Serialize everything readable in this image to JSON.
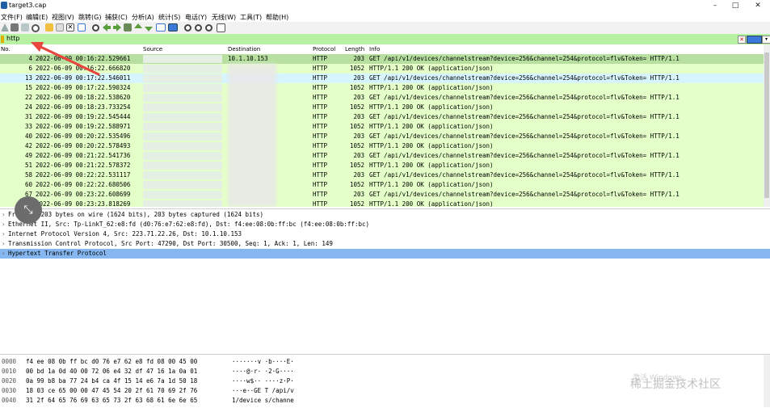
{
  "window": {
    "title": "target3.cap"
  },
  "menu": [
    "文件(F)",
    "编辑(E)",
    "视图(V)",
    "跳转(G)",
    "捕获(C)",
    "分析(A)",
    "统计(S)",
    "电话(Y)",
    "无线(W)",
    "工具(T)",
    "帮助(H)"
  ],
  "filter": {
    "value": "http"
  },
  "columns": {
    "no": "No.",
    "time": "Time",
    "source": "Source",
    "destination": "Destination",
    "protocol": "Protocol",
    "length": "Length",
    "info": "Info"
  },
  "packets": [
    {
      "no": "4",
      "time": "2022-06-09 00:16:22.529661",
      "destination": "10.1.10.153",
      "protocol": "HTTP",
      "length": "203",
      "info": "GET /api/v1/devices/channelstream?device=256&channel=254&protocol=flv&Token= HTTP/1.1"
    },
    {
      "no": "6",
      "time": "2022-06-09 00:16:22.666820",
      "destination": "",
      "protocol": "HTTP",
      "length": "1052",
      "info": "HTTP/1.1 200 OK  (application/json)"
    },
    {
      "no": "13",
      "time": "2022-06-09 00:17:22.546011",
      "destination": "",
      "protocol": "HTTP",
      "length": "203",
      "info": "GET /api/v1/devices/channelstream?device=256&channel=254&protocol=flv&Token= HTTP/1.1"
    },
    {
      "no": "15",
      "time": "2022-06-09 00:17:22.590324",
      "destination": "",
      "protocol": "HTTP",
      "length": "1052",
      "info": "HTTP/1.1 200 OK  (application/json)"
    },
    {
      "no": "22",
      "time": "2022-06-09 00:18:22.538620",
      "destination": "",
      "protocol": "HTTP",
      "length": "203",
      "info": "GET /api/v1/devices/channelstream?device=256&channel=254&protocol=flv&Token= HTTP/1.1"
    },
    {
      "no": "24",
      "time": "2022-06-09 00:18:23.733254",
      "destination": "",
      "protocol": "HTTP",
      "length": "1052",
      "info": "HTTP/1.1 200 OK  (application/json)"
    },
    {
      "no": "31",
      "time": "2022-06-09 00:19:22.545444",
      "destination": "",
      "protocol": "HTTP",
      "length": "203",
      "info": "GET /api/v1/devices/channelstream?device=256&channel=254&protocol=flv&Token= HTTP/1.1"
    },
    {
      "no": "33",
      "time": "2022-06-09 00:19:22.588971",
      "destination": "",
      "protocol": "HTTP",
      "length": "1052",
      "info": "HTTP/1.1 200 OK  (application/json)"
    },
    {
      "no": "40",
      "time": "2022-06-09 00:20:22.535496",
      "destination": "",
      "protocol": "HTTP",
      "length": "203",
      "info": "GET /api/v1/devices/channelstream?device=256&channel=254&protocol=flv&Token= HTTP/1.1"
    },
    {
      "no": "42",
      "time": "2022-06-09 00:20:22.578493",
      "destination": "",
      "protocol": "HTTP",
      "length": "1052",
      "info": "HTTP/1.1 200 OK  (application/json)"
    },
    {
      "no": "49",
      "time": "2022-06-09 00:21:22.541736",
      "destination": "",
      "protocol": "HTTP",
      "length": "203",
      "info": "GET /api/v1/devices/channelstream?device=256&channel=254&protocol=flv&Token= HTTP/1.1"
    },
    {
      "no": "51",
      "time": "2022-06-09 00:21:22.578372",
      "destination": "",
      "protocol": "HTTP",
      "length": "1052",
      "info": "HTTP/1.1 200 OK  (application/json)"
    },
    {
      "no": "58",
      "time": "2022-06-09 00:22:22.531117",
      "destination": "",
      "protocol": "HTTP",
      "length": "203",
      "info": "GET /api/v1/devices/channelstream?device=256&channel=254&protocol=flv&Token= HTTP/1.1"
    },
    {
      "no": "60",
      "time": "2022-06-09 00:22:22.680506",
      "destination": "",
      "protocol": "HTTP",
      "length": "1052",
      "info": "HTTP/1.1 200 OK  (application/json)"
    },
    {
      "no": "67",
      "time": "2022-06-09 00:23:22.608699",
      "destination": "",
      "protocol": "HTTP",
      "length": "203",
      "info": "GET /api/v1/devices/channelstream?device=256&channel=254&protocol=flv&Token= HTTP/1.1"
    },
    {
      "no": "69",
      "time": "2022-06-09 00:23:23.818269",
      "destination": "",
      "protocol": "HTTP",
      "length": "1052",
      "info": "HTTP/1.1 200 OK  (application/json)"
    }
  ],
  "details": [
    "Frame 4: 203 bytes on wire (1624 bits), 203 bytes captured (1624 bits)",
    "Ethernet II, Src: Tp-LinkT_62:e8:fd (d0:76:e7:62:e8:fd), Dst: f4:ee:08:0b:ff:bc (f4:ee:08:0b:ff:bc)",
    "Internet Protocol Version 4, Src: 223.71.22.26, Dst: 10.1.10.153",
    "Transmission Control Protocol, Src Port: 47290, Dst Port: 30500, Seq: 1, Ack: 1, Len: 149",
    "Hypertext Transfer Protocol"
  ],
  "bytes": [
    {
      "off": "0000",
      "hex": "f4 ee 08 0b ff bc d0 76  e7 62 e8 fd 08 00 45 00",
      "ascii": "·······v ·b····E·"
    },
    {
      "off": "0010",
      "hex": "00 bd 1a 0d 40 00 72 06  e4 32 df 47 16 1a 0a 01",
      "ascii": "····@·r· ·2·G····"
    },
    {
      "off": "0020",
      "hex": "0a 99 b8 ba 77 24 b4 ca  4f 15 14 e6 7a 1d 50 18",
      "ascii": "····w$·· ····z·P·"
    },
    {
      "off": "0030",
      "hex": "18 03 ce 65 00 00 47 45  54 20 2f 61 70 69 2f 76",
      "ascii": "···e··GE T /api/v"
    },
    {
      "off": "0040",
      "hex": "31 2f 64 65 76 69 63 65  73 2f 63 68 61 6e 6e 65",
      "ascii": "1/device s/channe"
    }
  ],
  "watermark": {
    "main": "稀土掘金技术社区",
    "activate": "激活 Windows"
  },
  "colors": {
    "filter_bg": "#b7f2a3",
    "row_bg": "#e4ffc7",
    "selected_detail": "#86b7f0",
    "annotation_arrow": "#e8453c"
  }
}
